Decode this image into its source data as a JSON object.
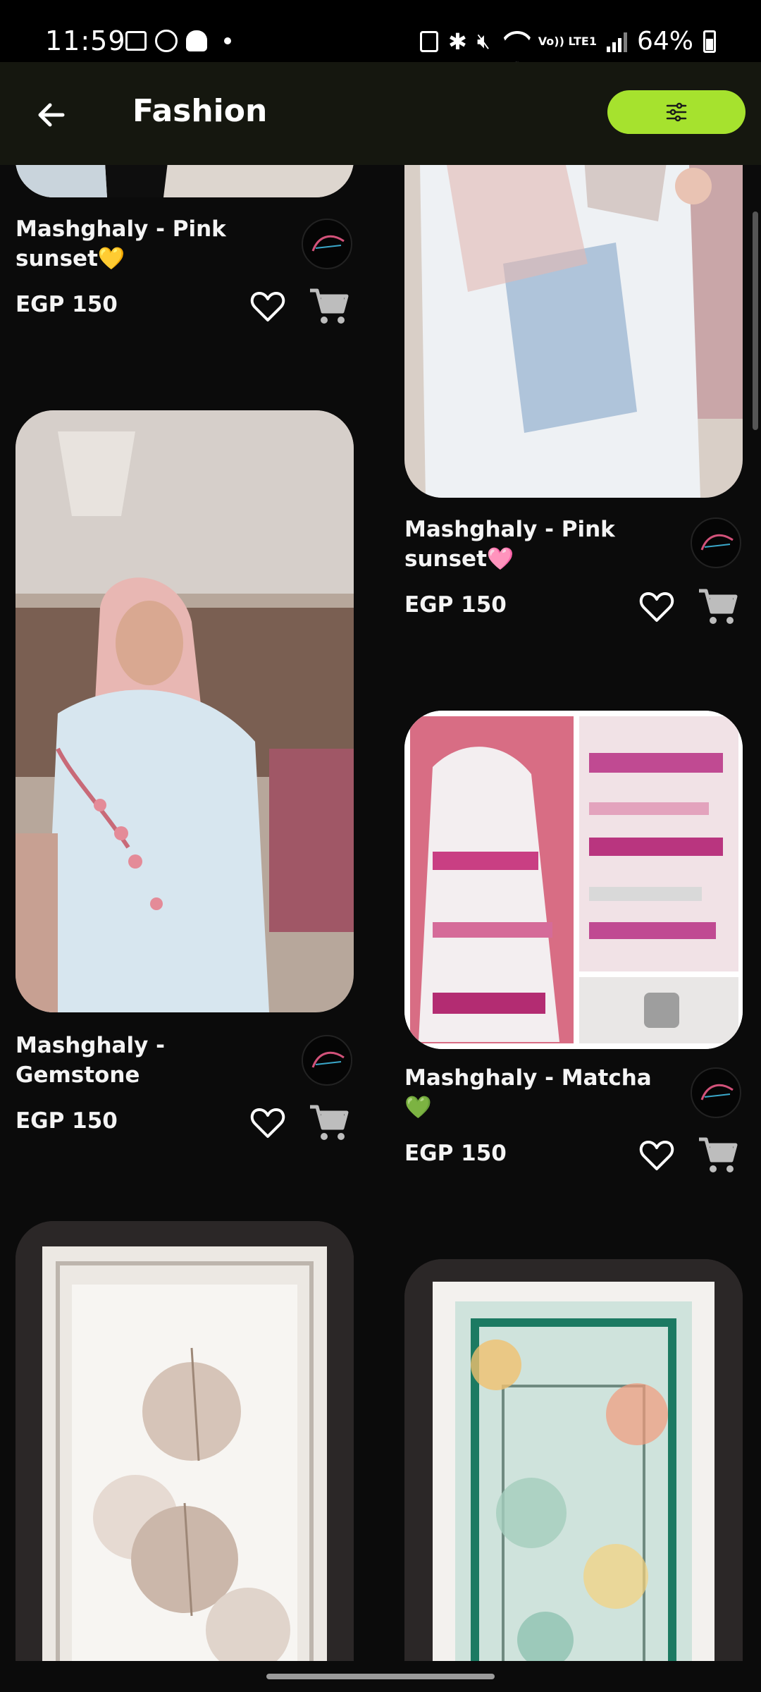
{
  "status_bar": {
    "time": "11:59",
    "battery": "64%",
    "network": "Vo)) LTE1"
  },
  "app_bar": {
    "title": "Fashion",
    "back_icon": "arrow-left-icon",
    "filter_icon": "sliders-icon",
    "accent_color": "#a6e22e"
  },
  "products": [
    {
      "title": "Mashghaly - Pink sunset💛",
      "price": "EGP 150"
    },
    {
      "title": "Mashghaly - Pink sunset🩷",
      "price": "EGP 150"
    },
    {
      "title": "Mashghaly - Gemstone",
      "price": "EGP 150"
    },
    {
      "title": "Mashghaly - Matcha💚",
      "price": "EGP 150"
    }
  ],
  "icons": {
    "favorite": "heart-outline-icon",
    "cart": "shopping-cart-icon"
  }
}
